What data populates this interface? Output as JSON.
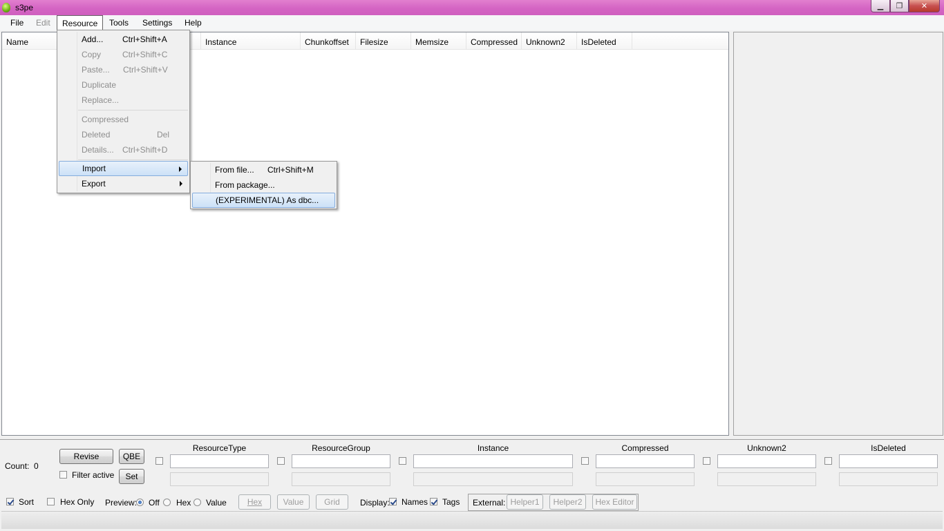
{
  "window": {
    "title": "s3pe"
  },
  "menubar": {
    "items": [
      {
        "label": "File"
      },
      {
        "label": "Edit"
      },
      {
        "label": "Resource"
      },
      {
        "label": "Tools"
      },
      {
        "label": "Settings"
      },
      {
        "label": "Help"
      }
    ]
  },
  "resource_menu": {
    "items": [
      {
        "label": "Add...",
        "shortcut": "Ctrl+Shift+A"
      },
      {
        "label": "Copy",
        "shortcut": "Ctrl+Shift+C"
      },
      {
        "label": "Paste...",
        "shortcut": "Ctrl+Shift+V"
      },
      {
        "label": "Duplicate"
      },
      {
        "label": "Replace..."
      },
      {
        "label": "Compressed"
      },
      {
        "label": "Deleted",
        "shortcut": "Del"
      },
      {
        "label": "Details...",
        "shortcut": "Ctrl+Shift+D"
      },
      {
        "label": "Import"
      },
      {
        "label": "Export"
      }
    ]
  },
  "import_submenu": {
    "items": [
      {
        "label": "From file...",
        "shortcut": "Ctrl+Shift+M"
      },
      {
        "label": "From package..."
      },
      {
        "label": "(EXPERIMENTAL) As dbc..."
      }
    ]
  },
  "listview": {
    "columns": [
      "Name",
      "Instance",
      "Chunkoffset",
      "Filesize",
      "Memsize",
      "Compressed",
      "Unknown2",
      "IsDeleted"
    ]
  },
  "filter": {
    "count_label": "Count:",
    "count_value": "0",
    "revise_label": "Revise",
    "qbe_label": "QBE",
    "set_label": "Set",
    "filter_active_label": "Filter active",
    "fields": [
      "ResourceType",
      "ResourceGroup",
      "Instance",
      "Compressed",
      "Unknown2",
      "IsDeleted"
    ]
  },
  "options": {
    "sort_label": "Sort",
    "hex_only_label": "Hex Only",
    "preview_label": "Preview:",
    "preview_off": "Off",
    "preview_hex": "Hex",
    "preview_value": "Value",
    "btn_hex": "Hex",
    "btn_value": "Value",
    "btn_grid": "Grid",
    "display_label": "Display:",
    "names_label": "Names",
    "tags_label": "Tags",
    "external_label": "External:",
    "helper1": "Helper1",
    "helper2": "Helper2",
    "hex_editor": "Hex Editor"
  }
}
